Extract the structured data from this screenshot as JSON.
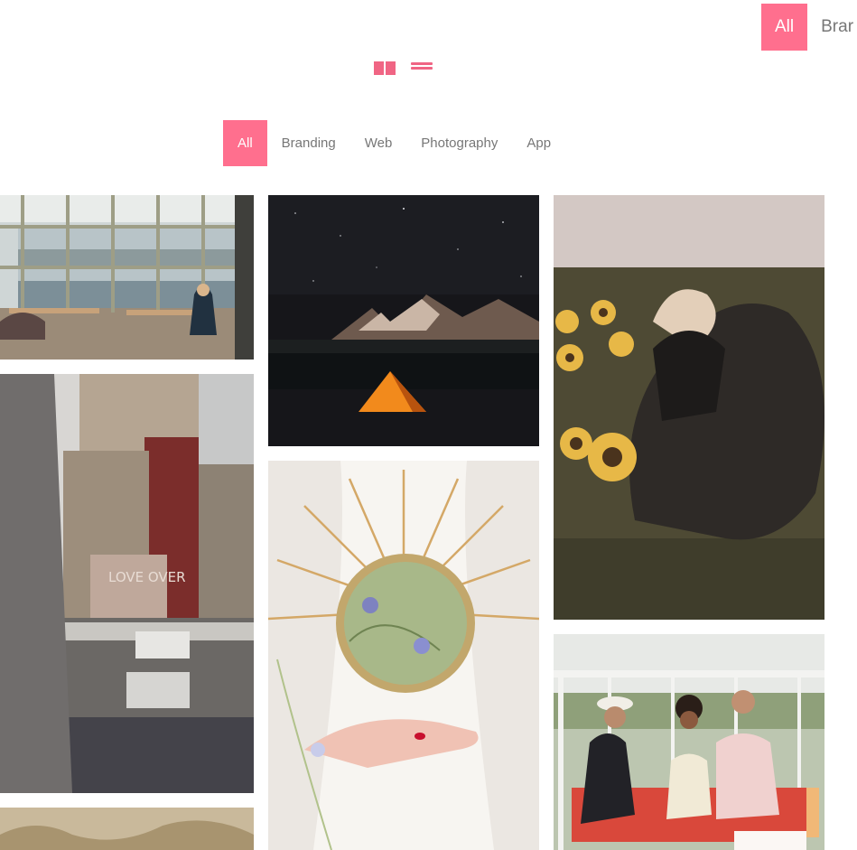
{
  "top_filter": {
    "items": [
      "All",
      "Brar"
    ]
  },
  "main_filter": {
    "items": [
      "All",
      "Branding",
      "Web",
      "Photography",
      "App"
    ]
  },
  "view_toggle": {
    "grid_icon": "grid-icon",
    "list_icon": "list-icon"
  },
  "gallery": {
    "items": [
      {
        "name": "office-photo"
      },
      {
        "name": "tent-photo"
      },
      {
        "name": "sunflower-photo"
      },
      {
        "name": "city-rooftop-photo",
        "sign_text": "LOVE OVER"
      },
      {
        "name": "mirror-photo"
      },
      {
        "name": "picnic-photo"
      },
      {
        "name": "field-photo"
      }
    ]
  },
  "colors": {
    "accent": "#ff6f8e",
    "text": "#777777"
  }
}
